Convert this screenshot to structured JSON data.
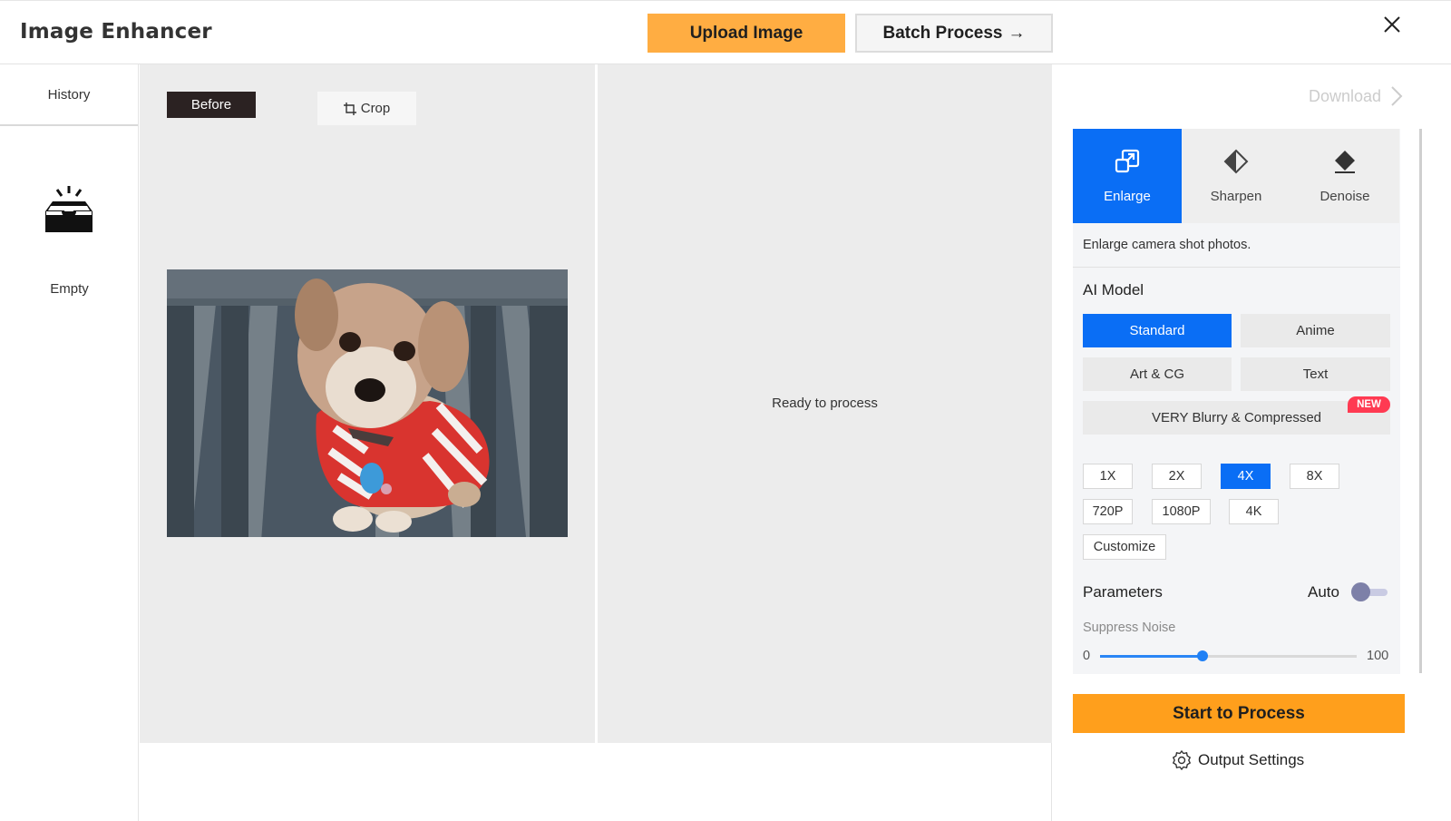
{
  "header": {
    "app_title": "Image Enhancer",
    "upload_label": "Upload Image",
    "batch_label": "Batch Process",
    "batch_arrow": "→",
    "accent_color": "#ffad42"
  },
  "sidebar": {
    "history_label": "History",
    "empty_label": "Empty"
  },
  "canvas": {
    "before_label": "Before",
    "crop_label": "Crop",
    "ready_text": "Ready to process"
  },
  "panel": {
    "download_label": "Download",
    "modes": [
      {
        "label": "Enlarge",
        "icon": "enlarge-icon",
        "active": true
      },
      {
        "label": "Sharpen",
        "icon": "sharpen-icon",
        "active": false
      },
      {
        "label": "Denoise",
        "icon": "denoise-icon",
        "active": false
      }
    ],
    "mode_description": "Enlarge camera shot photos.",
    "ai_model_title": "AI Model",
    "models": [
      {
        "label": "Standard",
        "active": true
      },
      {
        "label": "Anime",
        "active": false
      },
      {
        "label": "Art & CG",
        "active": false
      },
      {
        "label": "Text",
        "active": false
      },
      {
        "label": "VERY Blurry & Compressed",
        "active": false
      }
    ],
    "new_badge": "NEW",
    "scales": [
      {
        "label": "1X",
        "active": false
      },
      {
        "label": "2X",
        "active": false
      },
      {
        "label": "4X",
        "active": true
      },
      {
        "label": "8X",
        "active": false
      },
      {
        "label": "720P",
        "active": false
      },
      {
        "label": "1080P",
        "active": false
      },
      {
        "label": "4K",
        "active": false
      },
      {
        "label": "Customize",
        "active": false
      }
    ],
    "parameters_label": "Parameters",
    "auto_label": "Auto",
    "auto_enabled": false,
    "suppress_noise_label": "Suppress Noise",
    "suppress_noise_min": "0",
    "suppress_noise_max": "100",
    "suppress_noise_value": 40,
    "start_label": "Start to Process",
    "output_settings_label": "Output Settings",
    "primary_color": "#0a6ef5",
    "start_color": "#ff9f1c"
  }
}
